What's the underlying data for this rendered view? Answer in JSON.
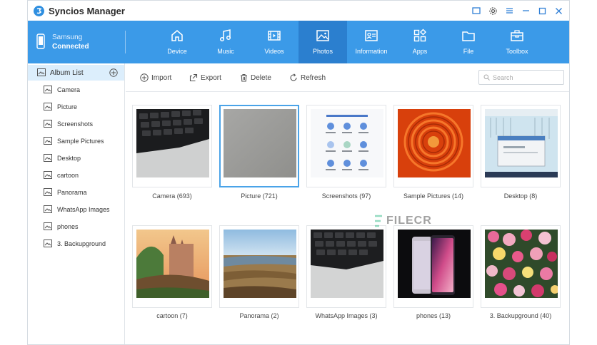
{
  "app": {
    "title": "Syncios Manager"
  },
  "device": {
    "name": "Samsung",
    "status": "Connected"
  },
  "nav": {
    "tabs": [
      {
        "label": "Device",
        "icon": "home-icon"
      },
      {
        "label": "Music",
        "icon": "music-icon"
      },
      {
        "label": "Videos",
        "icon": "video-icon"
      },
      {
        "label": "Photos",
        "icon": "photo-icon",
        "active": true
      },
      {
        "label": "Information",
        "icon": "contact-card-icon"
      },
      {
        "label": "Apps",
        "icon": "apps-icon"
      },
      {
        "label": "File",
        "icon": "folder-icon"
      },
      {
        "label": "Toolbox",
        "icon": "toolbox-icon"
      }
    ]
  },
  "sidebar": {
    "header": "Album List",
    "items": [
      {
        "label": "Camera"
      },
      {
        "label": "Picture"
      },
      {
        "label": "Screenshots"
      },
      {
        "label": "Sample Pictures"
      },
      {
        "label": "Desktop"
      },
      {
        "label": "cartoon"
      },
      {
        "label": "Panorama"
      },
      {
        "label": "WhatsApp Images"
      },
      {
        "label": "phones"
      },
      {
        "label": "3. Backupground"
      }
    ]
  },
  "toolbar": {
    "import_label": "Import",
    "export_label": "Export",
    "delete_label": "Delete",
    "refresh_label": "Refresh",
    "search_placeholder": "Search"
  },
  "albums": [
    {
      "label": "Camera (693)"
    },
    {
      "label": "Picture (721)",
      "selected": true
    },
    {
      "label": "Screenshots (97)"
    },
    {
      "label": "Sample Pictures (14)"
    },
    {
      "label": "Desktop (8)"
    },
    {
      "label": "cartoon (7)"
    },
    {
      "label": "Panorama (2)"
    },
    {
      "label": "WhatsApp Images (3)"
    },
    {
      "label": "phones (13)"
    },
    {
      "label": "3. Backupground (40)"
    }
  ],
  "watermark": {
    "text": "FILECR"
  },
  "colors": {
    "nav_bg": "#3b9ae8",
    "nav_active": "#2b7fcf",
    "sidebar_selected": "#dceefc",
    "tile_selected_border": "#4aa3e8"
  }
}
